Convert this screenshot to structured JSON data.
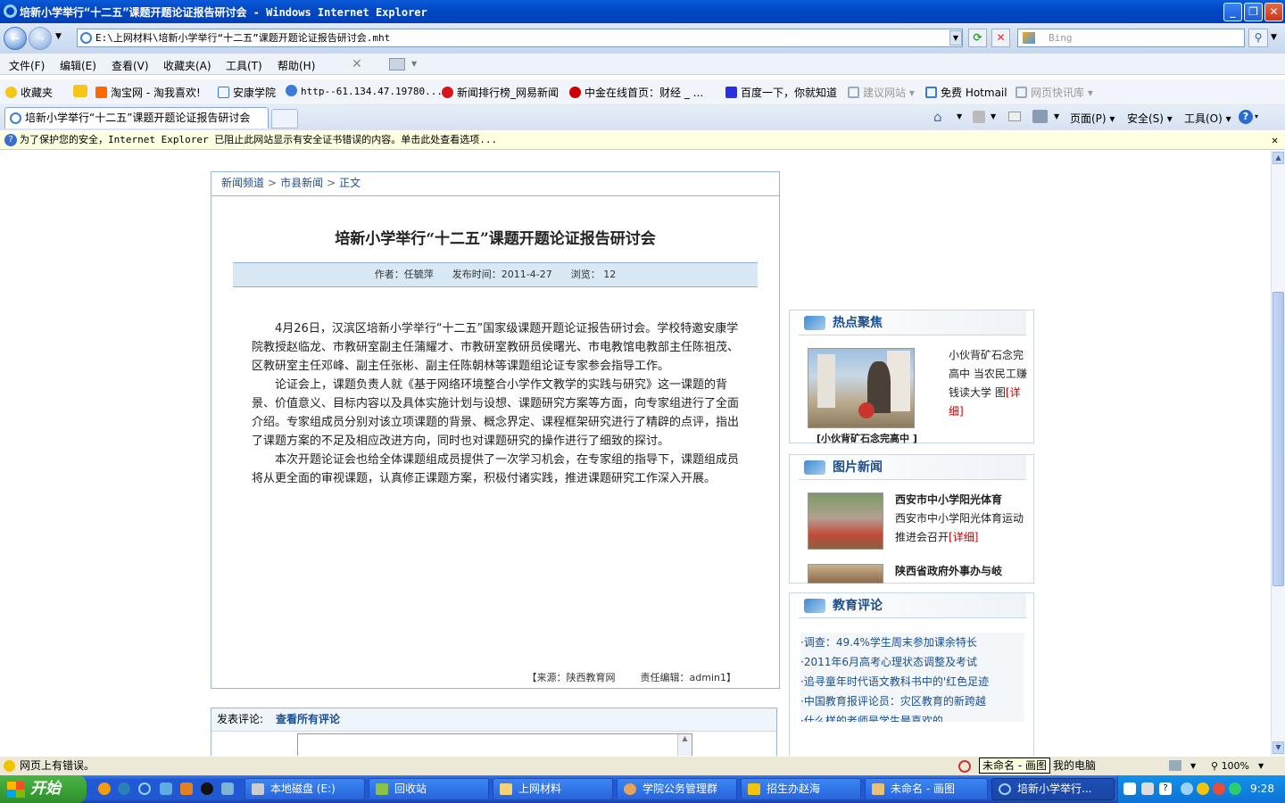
{
  "window": {
    "title": "培新小学举行“十二五”课题开题论证报告研讨会 - Windows Internet Explorer",
    "minimize": "_",
    "maximize": "❐",
    "close": "✕"
  },
  "address": {
    "url": "E:\\上网材料\\培新小学举行“十二五”课题开题论证报告研讨会.mht",
    "search_placeholder": "Bing"
  },
  "menu": [
    "文件(F)",
    "编辑(E)",
    "查看(V)",
    "收藏夹(A)",
    "工具(T)",
    "帮助(H)"
  ],
  "favorites": {
    "label": "收藏夹",
    "items": [
      "淘宝网 - 淘我喜欢!",
      "安康学院",
      "http--61.134.47.19780...",
      "新闻排行榜_网易新闻",
      "中金在线首页：财经 _ ...",
      "百度一下，你就知道",
      "建议网站 ▾",
      "免费 Hotmail",
      "网页快讯库 ▾"
    ]
  },
  "tab": {
    "label": "培新小学举行“十二五”课题开题论证报告研讨会"
  },
  "commandbar": {
    "page": "页面(P) ▾",
    "safety": "安全(S) ▾",
    "tools": "工具(O) ▾",
    "help": "▾"
  },
  "infobar": {
    "text": "为了保护您的安全，Internet Explorer 已阻止此网站显示有安全证书错误的内容。单击此处查看选项..."
  },
  "article": {
    "breadcrumb": [
      "新闻频道",
      "市县新闻",
      "正文"
    ],
    "title": "培新小学举行“十二五”课题开题论证报告研讨会",
    "meta": {
      "author": "作者：任毓萍",
      "date": "发布时间：2011-4-27",
      "views": "浏览： 12"
    },
    "paragraphs": [
      "4月26日，汉滨区培新小学举行“十二五”国家级课题开题论证报告研讨会。学校特邀安康学院教授赵临龙、市教研室副主任蒲耀才、市教研室教研员侯曙光、市电教馆电教部主任陈祖茂、区教研室主任邓峰、副主任张彬、副主任陈朝林等课题组论证专家参会指导工作。",
      "论证会上，课题负责人就《基于网络环境整合小学作文教学的实践与研究》这一课题的背景、价值意义、目标内容以及具体实施计划与设想、课题研究方案等方面，向专家组进行了全面介绍。专家组成员分别对该立项课题的背景、概念界定、课程框架研究进行了精辟的点评，指出了课题方案的不足及相应改进方向，同时也对课题研究的操作进行了细致的探讨。",
      "本次开题论证会也给全体课题组成员提供了一次学习机会，在专家组的指导下，课题组成员将从更全面的审视课题，认真修正课题方案，积极付诸实践，推进课题研究工作深入开展。"
    ],
    "source": "【来源：陕西教育网",
    "editor": "责任编辑：admin1】"
  },
  "comments": {
    "label": "发表评论:",
    "view_all": "查看所有评论"
  },
  "hot": {
    "title": "热点聚焦",
    "caption": "小伙背矿石念完高中 当农民工赚钱读大学 图",
    "more": "[详细]",
    "cut_caption": "[小伙背矿石念完高中 ]"
  },
  "photo_news": {
    "title": "图片新闻",
    "item1_title": "西安市中小学阳光体育",
    "item1_desc": "西安市中小学阳光体育运动推进会召开",
    "more": "[详细]",
    "item2_title": "陕西省政府外事办与岐"
  },
  "edu_review": {
    "title": "教育评论",
    "items": [
      "·调查：49.4%学生周末参加课余特长",
      "·2011年6月高考心理状态调整及考试",
      "·追寻童年时代语文教科书中的'红色足迹",
      "·中国教育报评论员：灾区教育的新跨越",
      "·什么样的老师是学生最喜欢的"
    ]
  },
  "status": {
    "text": "网页上有错误。",
    "zone": "我的电脑",
    "zoom": "100%"
  },
  "taskbar": {
    "start": "开始",
    "tasks": [
      "本地磁盘 (E:)",
      "回收站",
      "上网材料",
      "学院公务管理群",
      "招生办赵海",
      "未命名 - 画图",
      "培新小学举行..."
    ],
    "tooltip": "未命名 - 画图",
    "time": "9:28"
  },
  "colors": {
    "titlebar": "#0348c4",
    "link": "#1c4e8c",
    "more": "#cc0000",
    "taskbar": "#2158d4"
  }
}
